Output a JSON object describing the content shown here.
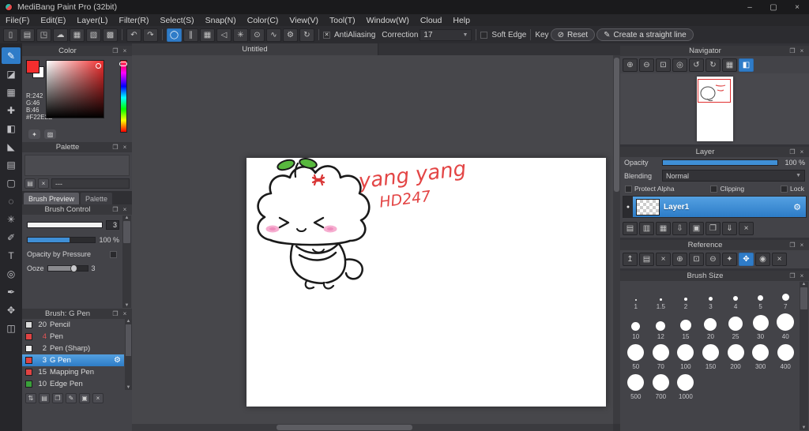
{
  "window": {
    "title": "MediBang Paint Pro (32bit)"
  },
  "menu": {
    "items": [
      "File(F)",
      "Edit(E)",
      "Layer(L)",
      "Filter(R)",
      "Select(S)",
      "Snap(N)",
      "Color(C)",
      "View(V)",
      "Tool(T)",
      "Window(W)",
      "Cloud",
      "Help"
    ]
  },
  "toolbar": {
    "antialiasing": "AntiAliasing",
    "correction_label": "Correction",
    "correction_value": "17",
    "soft_edge": "Soft Edge",
    "key": "Key",
    "reset": "Reset",
    "straight_line": "Create a straight line"
  },
  "color_panel": {
    "title": "Color",
    "r": "R:242",
    "g": "G:46",
    "b": "B:46",
    "hex": "#F22E2E",
    "swatch_style": "background:#f22e2e"
  },
  "palette_panel": {
    "title": "Palette",
    "empty": "---"
  },
  "preview_tabs": {
    "brush_preview": "Brush Preview",
    "palette": "Palette"
  },
  "brush_control": {
    "title": "Brush Control",
    "size_value": "3",
    "opacity_value": "100 %",
    "pressure_label": "Opacity by Pressure",
    "ooze_label": "Ooze",
    "ooze_value": "3"
  },
  "brush_panel": {
    "title": "Brush: G Pen",
    "items": [
      {
        "size": "20",
        "name": "Pencil",
        "chip_style": "background:#dcdcdc"
      },
      {
        "size": "4",
        "name": "Pen",
        "chip_style": "background:#e04343"
      },
      {
        "size": "2",
        "name": "Pen (Sharp)",
        "chip_style": "background:#f0f0f0"
      },
      {
        "size": "3",
        "name": "G Pen",
        "chip_style": "background:#e04343"
      },
      {
        "size": "15",
        "name": "Mapping Pen",
        "chip_style": "background:#e04343"
      },
      {
        "size": "10",
        "name": "Edge Pen",
        "chip_style": "background:#3aa13a"
      }
    ]
  },
  "canvas": {
    "tab": "Untitled",
    "annotation1": "yang yang",
    "annotation2": "HD247"
  },
  "navigator": {
    "title": "Navigator"
  },
  "layer_panel": {
    "title": "Layer",
    "opacity_label": "Opacity",
    "opacity_value": "100 %",
    "blending_label": "Blending",
    "blending_value": "Normal",
    "protect_alpha": "Protect Alpha",
    "clipping": "Clipping",
    "lock": "Lock",
    "layer_name": "Layer1"
  },
  "reference_panel": {
    "title": "Reference"
  },
  "brush_size_panel": {
    "title": "Brush Size",
    "sizes": [
      "1",
      "1.5",
      "2",
      "3",
      "4",
      "5",
      "7",
      "10",
      "12",
      "15",
      "20",
      "25",
      "30",
      "40",
      "50",
      "70",
      "100",
      "150",
      "200",
      "300",
      "400",
      "500",
      "700",
      "1000"
    ]
  },
  "colors": {
    "accent": "#3f8fd6",
    "foreground": "#f22e2e",
    "selection_red": "#e03030"
  }
}
